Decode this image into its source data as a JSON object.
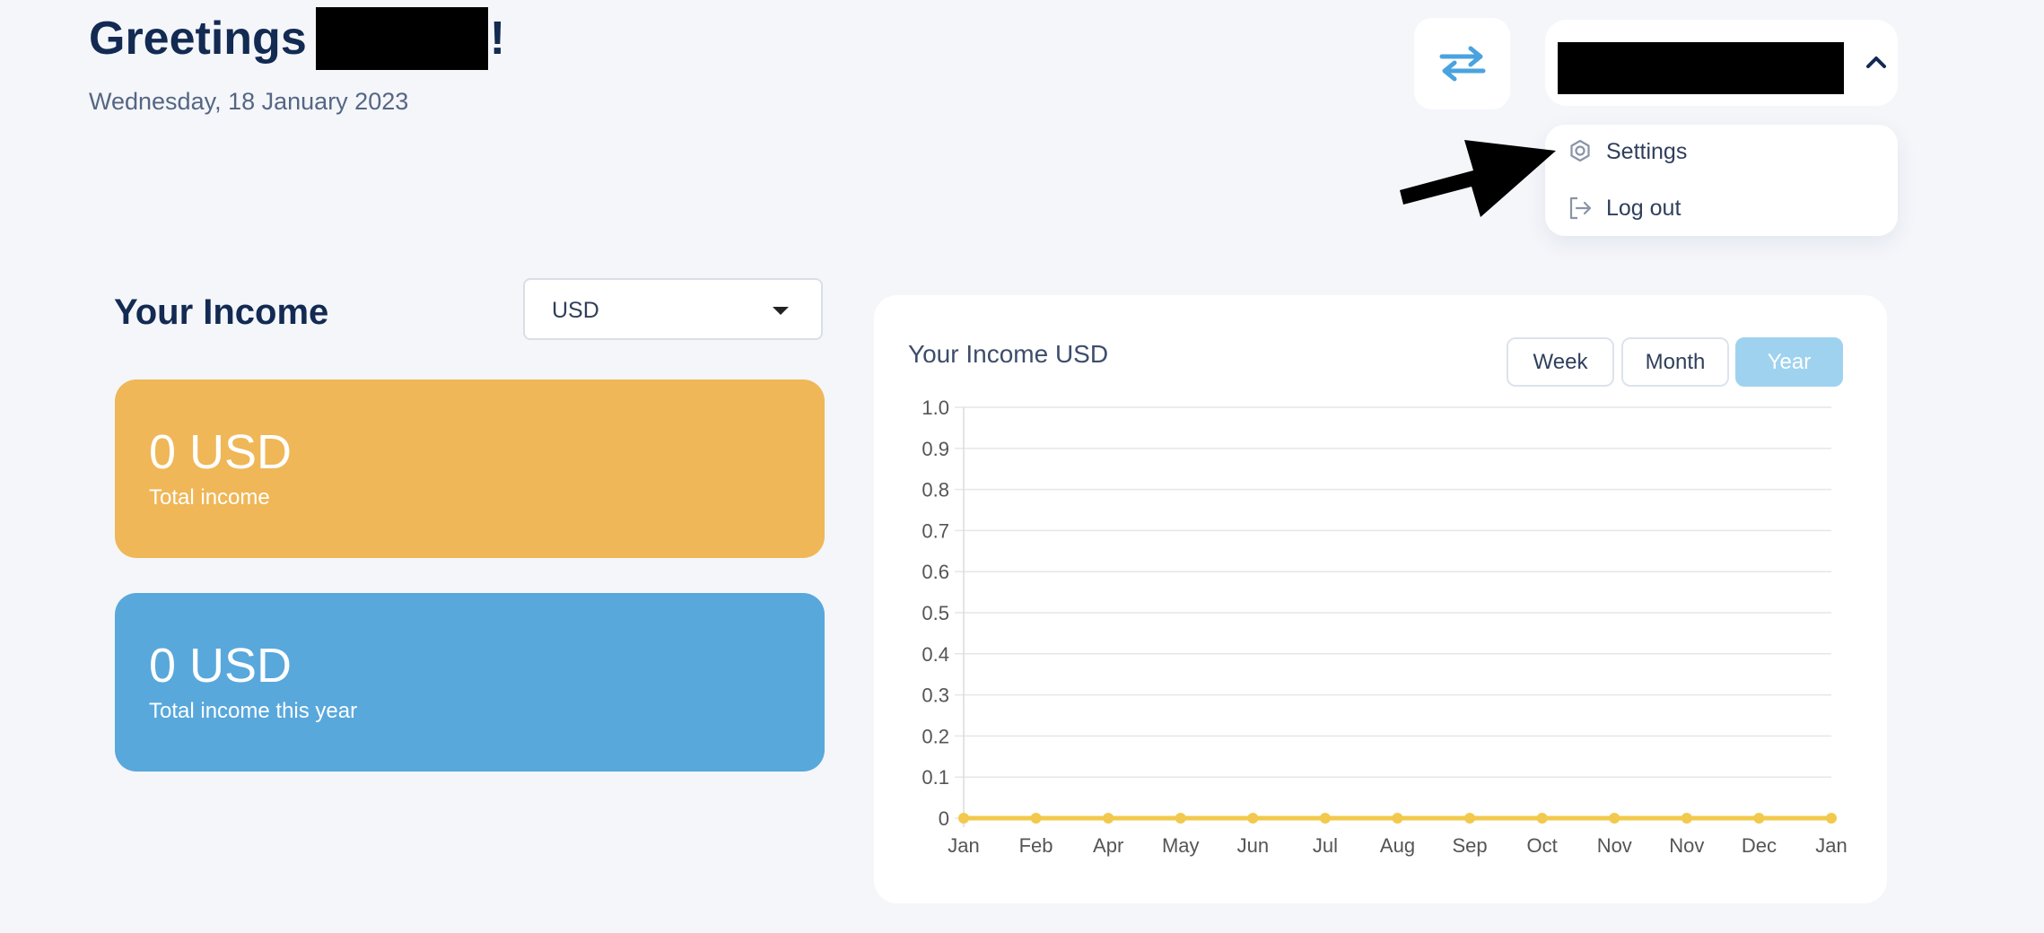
{
  "header": {
    "greeting_prefix": "Greetings",
    "greeting_suffix": "!",
    "date": "Wednesday, 18 January 2023"
  },
  "user_menu": {
    "items": [
      {
        "label": "Settings",
        "icon": "gear-icon"
      },
      {
        "label": "Log out",
        "icon": "logout-icon"
      }
    ]
  },
  "income": {
    "title": "Your Income",
    "currency": "USD",
    "cards": [
      {
        "amount": "0 USD",
        "label": "Total income",
        "color": "#efb757"
      },
      {
        "amount": "0 USD",
        "label": "Total income this year",
        "color": "#58a8dc"
      }
    ]
  },
  "chart_panel": {
    "title": "Your Income USD",
    "timeframes": [
      "Week",
      "Month",
      "Year"
    ],
    "active_timeframe": "Year"
  },
  "chart_data": {
    "type": "line",
    "categories": [
      "Jan",
      "Feb",
      "Apr",
      "May",
      "Jun",
      "Jul",
      "Aug",
      "Sep",
      "Oct",
      "Nov",
      "Nov",
      "Dec",
      "Jan"
    ],
    "series": [
      {
        "values": [
          0,
          0,
          0,
          0,
          0,
          0,
          0,
          0,
          0,
          0,
          0,
          0,
          0
        ],
        "color": "#f2c94c"
      }
    ],
    "ylim": [
      0,
      1.0
    ],
    "yticks": [
      "1.0",
      "0.9",
      "0.8",
      "0.7",
      "0.6",
      "0.5",
      "0.4",
      "0.3",
      "0.2",
      "0.1",
      "0"
    ],
    "grid": true
  },
  "colors": {
    "accent": "#4aa3df",
    "title": "#132a52",
    "line": "#f2c94c"
  }
}
